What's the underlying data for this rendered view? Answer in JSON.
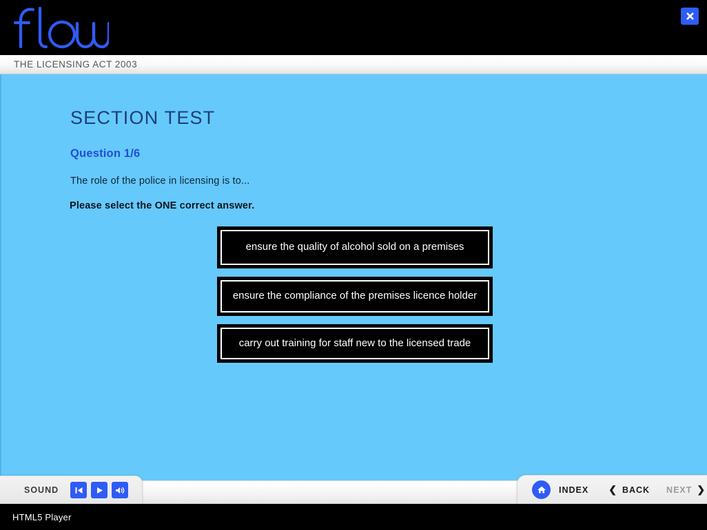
{
  "window": {
    "status_text": "HTML5 Player",
    "close_label": "close"
  },
  "brand": {
    "logo_text": "flow",
    "logo_color": "#2f5cf6"
  },
  "titlebar": {
    "course_title": "THE LICENSING ACT 2003"
  },
  "stage": {
    "background_color": "#65c9fb",
    "section_title": "SECTION TEST",
    "question_number": "Question 1/6",
    "question_text": "The role of the police in licensing is to...",
    "instruction": "Please select the ONE correct answer.",
    "answers": [
      {
        "label": "ensure the quality of alcohol sold on a premises"
      },
      {
        "label": "ensure the compliance of the premises licence holder"
      },
      {
        "label": "carry out training for staff new to the licensed trade"
      }
    ]
  },
  "toolbar": {
    "sound_label": "SOUND",
    "buttons": [
      {
        "name": "restart-audio",
        "icon": "skip-back-icon"
      },
      {
        "name": "play-audio",
        "icon": "play-icon"
      },
      {
        "name": "volume",
        "icon": "volume-icon"
      }
    ],
    "nav": {
      "home_icon": "home-icon",
      "index_label": "INDEX",
      "back_label": "BACK",
      "back_chevron": "❮",
      "next_label": "NEXT",
      "next_chevron": "❯",
      "next_disabled": true
    }
  }
}
